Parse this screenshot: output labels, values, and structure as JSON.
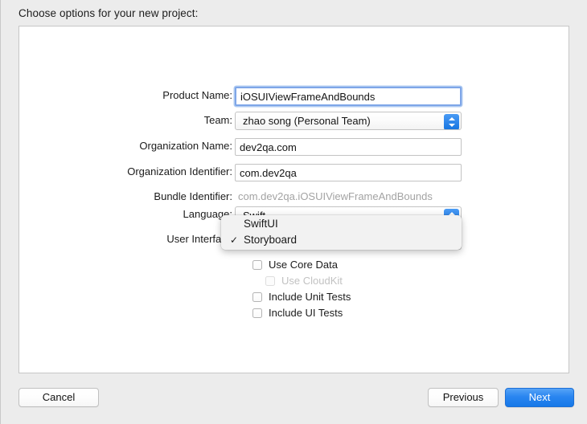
{
  "header": {
    "title": "Choose options for your new project:"
  },
  "form": {
    "fields": [
      {
        "label": "Product Name:",
        "value": "iOSUIViewFrameAndBounds",
        "type": "text",
        "focused": true
      },
      {
        "label": "Team:",
        "value": "zhao song (Personal Team)",
        "type": "popup"
      },
      {
        "label": "Organization Name:",
        "value": "dev2qa.com",
        "type": "text"
      },
      {
        "label": "Organization Identifier:",
        "value": "com.dev2qa",
        "type": "text"
      },
      {
        "label": "Bundle Identifier:",
        "value": "com.dev2qa.iOSUIViewFrameAndBounds",
        "type": "static"
      },
      {
        "label": "Language:",
        "value": "Swift",
        "type": "popup"
      },
      {
        "label": "User Interface",
        "value": "",
        "type": "popup"
      }
    ]
  },
  "dropdown": {
    "open": true,
    "items": [
      {
        "label": "SwiftUI",
        "checked": false
      },
      {
        "label": "Storyboard",
        "checked": true
      }
    ],
    "check_glyph": "✓"
  },
  "checkboxes": [
    {
      "label": "Use Core Data",
      "checked": false,
      "disabled": false
    },
    {
      "label": "Use CloudKit",
      "checked": false,
      "disabled": true
    },
    {
      "label": "Include Unit Tests",
      "checked": false,
      "disabled": false
    },
    {
      "label": "Include UI Tests",
      "checked": false,
      "disabled": false
    }
  ],
  "footer": {
    "cancel_label": "Cancel",
    "previous_label": "Previous",
    "next_label": "Next"
  },
  "colors": {
    "window_background": "#ececec",
    "panel_background": "#ffffff",
    "accent_blue": "#1678e8",
    "focus_ring": "#7ea6e8",
    "disabled_text": "#c2c2c2"
  }
}
